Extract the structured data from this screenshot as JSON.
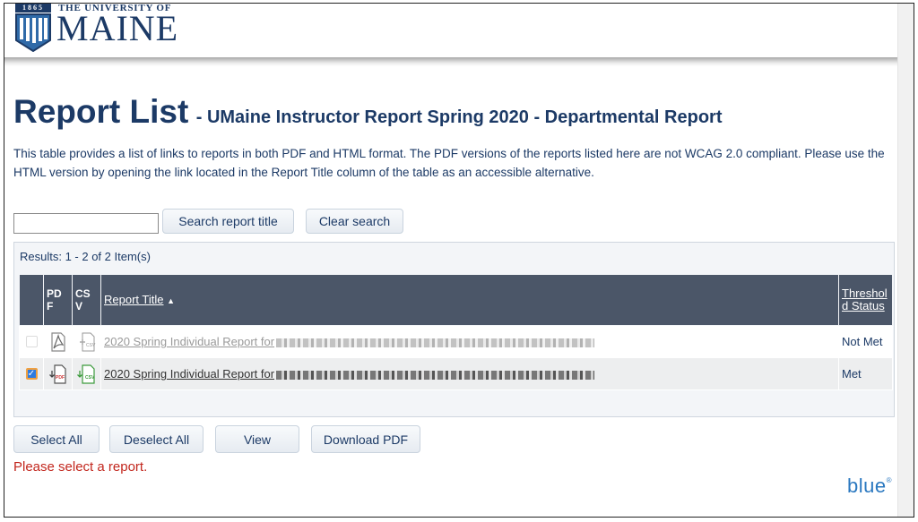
{
  "header": {
    "logo_year": "1865",
    "logo_top_line": "THE UNIVERSITY OF",
    "logo_name": "MAINE"
  },
  "page": {
    "title": "Report List",
    "subtitle": "- UMaine Instructor Report Spring 2020 - Departmental Report",
    "description": "This table provides a list of links to reports in both PDF and HTML format. The PDF versions of the reports listed here are not WCAG 2.0 compliant. Please use the HTML version by opening the link located in the Report Title column of the table as an accessible alternative."
  },
  "search": {
    "input_value": "",
    "search_button": "Search report title",
    "clear_button": "Clear search"
  },
  "results_text": "Results: 1 - 2 of 2 Item(s)",
  "table": {
    "headers": {
      "pdf": "PDF",
      "csv": "CSV",
      "report_title": "Report Title",
      "sort_indicator": "▲",
      "threshold": "Threshold Status"
    },
    "rows": [
      {
        "checked": false,
        "title": "2020 Spring Individual Report for",
        "status": "Not Met"
      },
      {
        "checked": true,
        "title": "2020 Spring Individual Report for",
        "status": "Met"
      }
    ]
  },
  "actions": {
    "select_all": "Select All",
    "deselect_all": "Deselect All",
    "view": "View",
    "download_pdf": "Download PDF"
  },
  "error_message": "Please select a report.",
  "brand": {
    "footer_logo": "blue",
    "footer_logo_mark": "®"
  },
  "colors": {
    "navy": "#1c3a66",
    "header_row": "#4b5668",
    "error": "#c2271e",
    "checkbox_checked": "#2e7be0"
  },
  "icons": [
    "pdf-icon",
    "csv-icon",
    "checkbox"
  ]
}
